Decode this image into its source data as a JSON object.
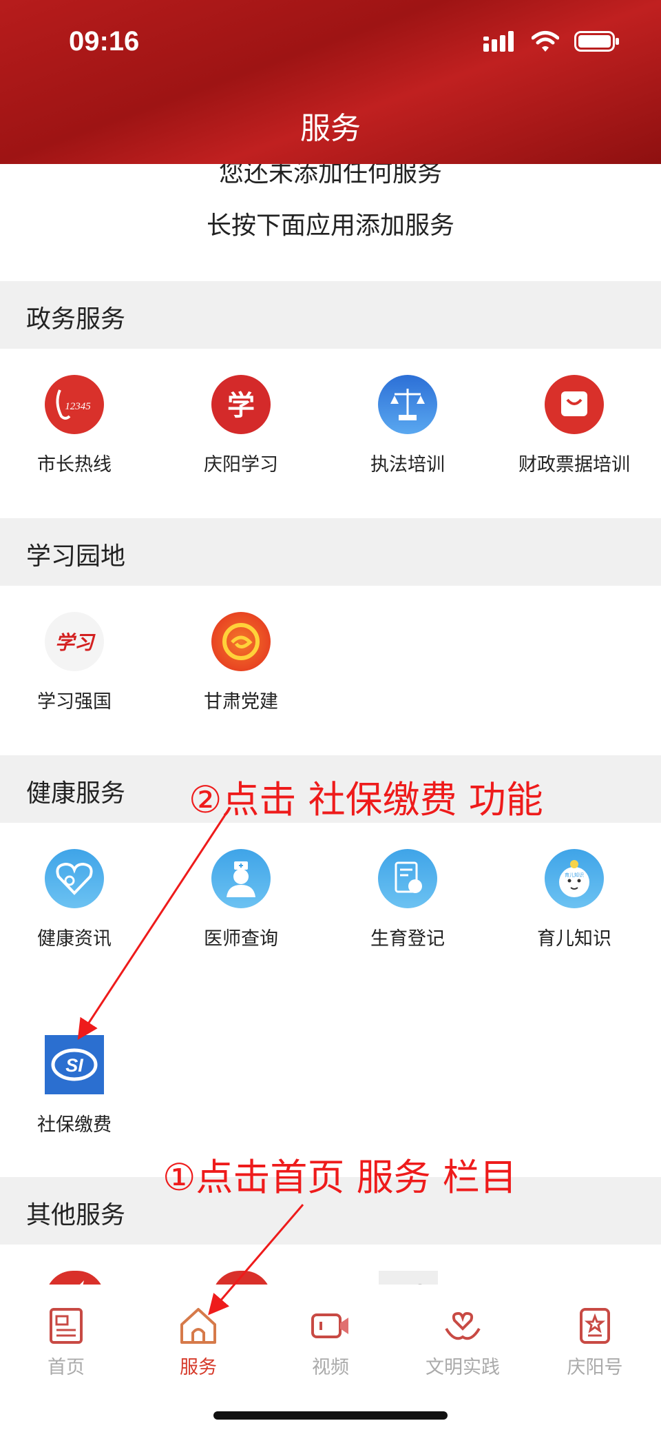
{
  "status_bar": {
    "time": "09:16"
  },
  "header": {
    "title": "服务"
  },
  "empty_notice": {
    "line1": "您还未添加任何服务",
    "line2": "长按下面应用添加服务"
  },
  "sections": {
    "gov": {
      "title": "政务服务",
      "items": [
        {
          "label": "市长热线",
          "icon": "hotline-12345-icon",
          "icon_text": "12345"
        },
        {
          "label": "庆阳学习",
          "icon": "qingyang-study-icon",
          "icon_text": "学"
        },
        {
          "label": "执法培训",
          "icon": "scales-justice-icon"
        },
        {
          "label": "财政票据培训",
          "icon": "shopping-bag-icon"
        }
      ]
    },
    "study": {
      "title": "学习园地",
      "items": [
        {
          "label": "学习强国",
          "icon": "xuexi-qiangguo-icon",
          "icon_text": "学习"
        },
        {
          "label": "甘肃党建",
          "icon": "gansu-party-icon"
        }
      ]
    },
    "health": {
      "title": "健康服务",
      "items": [
        {
          "label": "健康资讯",
          "icon": "heart-stethoscope-icon"
        },
        {
          "label": "医师查询",
          "icon": "doctor-icon"
        },
        {
          "label": "生育登记",
          "icon": "birth-register-icon"
        },
        {
          "label": "育儿知识",
          "icon": "baby-face-icon",
          "icon_text": "育儿知识"
        },
        {
          "label": "社保缴费",
          "icon": "social-insurance-si-icon",
          "icon_text": "SI"
        }
      ]
    },
    "other": {
      "title": "其他服务"
    }
  },
  "annotations": {
    "step2": "②点击 社保缴费 功能",
    "step1": "①点击首页 服务 栏目"
  },
  "tabbar": {
    "tabs": [
      {
        "label": "首页",
        "icon": "newspaper-icon"
      },
      {
        "label": "服务",
        "icon": "home-icon",
        "active": true
      },
      {
        "label": "视频",
        "icon": "video-camera-icon"
      },
      {
        "label": "文明实践",
        "icon": "heart-hands-icon"
      },
      {
        "label": "庆阳号",
        "icon": "star-badge-icon"
      }
    ]
  },
  "colors": {
    "brand_red": "#b71c1c",
    "annotation_red": "#ee1b1b",
    "active_tab": "#d63a2a"
  }
}
